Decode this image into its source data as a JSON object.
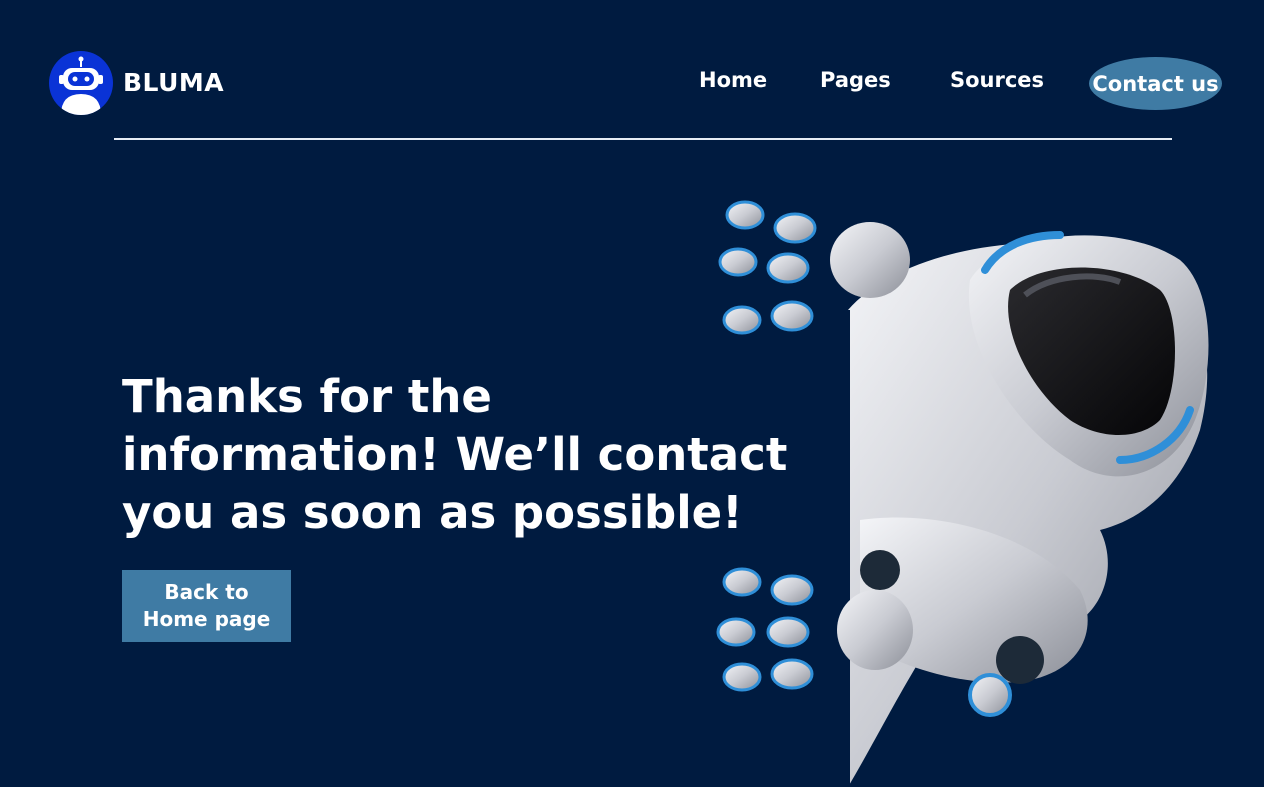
{
  "brand": {
    "name": "BLUMA",
    "logo_icon": "robot-icon"
  },
  "nav": {
    "home": "Home",
    "pages": "Pages",
    "sources": "Sources",
    "contact": "Contact us"
  },
  "main": {
    "headline": "Thanks for the information! We’ll contact you as soon as possible!",
    "back_button": {
      "line1": "Back to",
      "line2": "Home page"
    }
  },
  "colors": {
    "background": "#001b40",
    "accent": "#3f7ba4",
    "logo_badge": "#0a33d6"
  }
}
